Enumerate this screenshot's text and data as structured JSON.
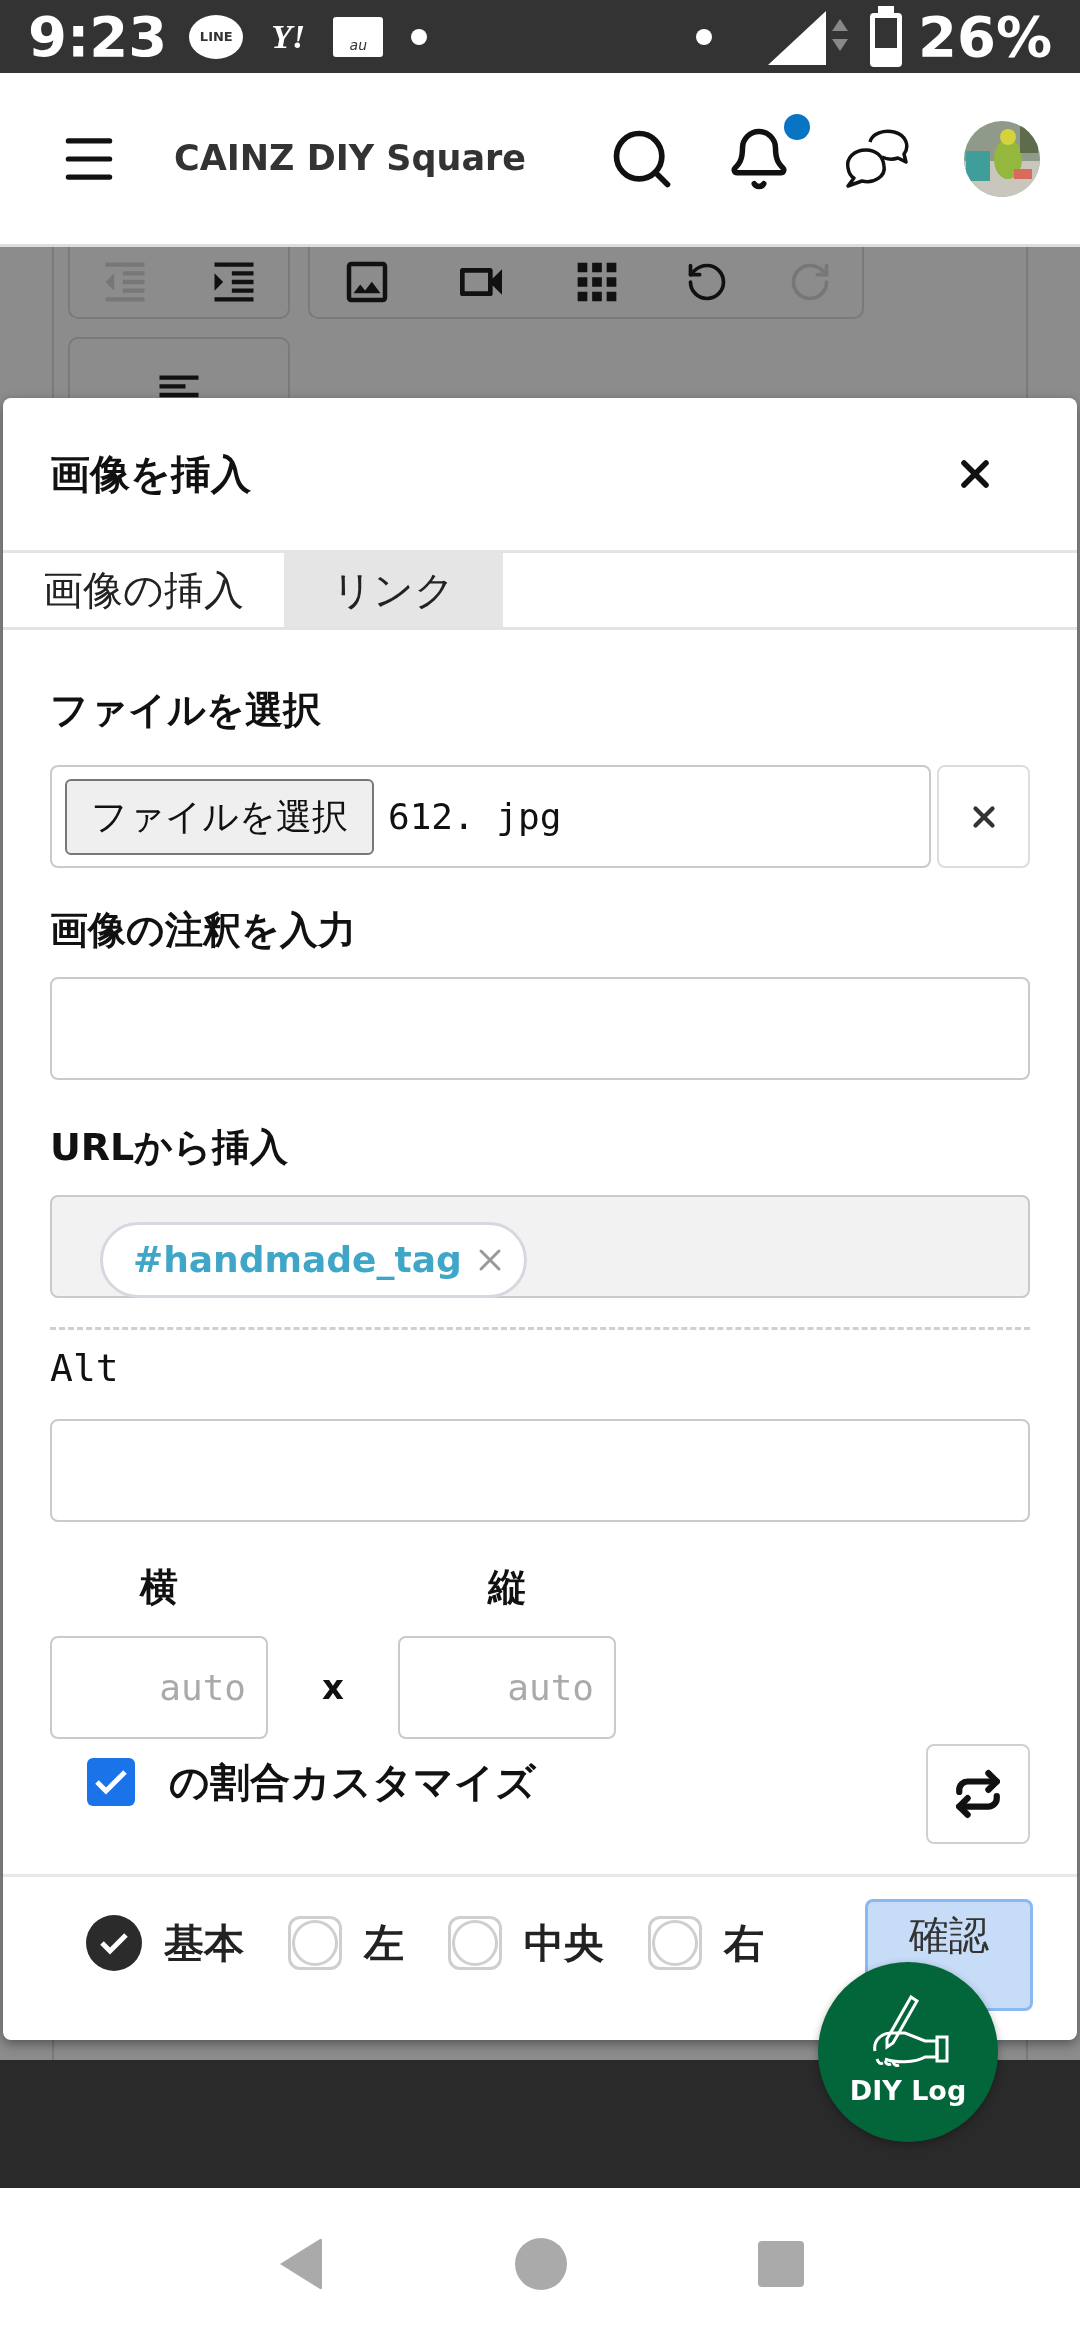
{
  "status_bar": {
    "time": "9:23",
    "notifications": [
      {
        "kind": "bubble",
        "label": "LINE"
      },
      {
        "kind": "plain",
        "label": "Y!"
      },
      {
        "kind": "mail",
        "label": "au"
      }
    ],
    "battery": "26%"
  },
  "header": {
    "title": "CAINZ DIY Square",
    "notification_dot": true
  },
  "dialog": {
    "title": "画像を挿入",
    "tabs": [
      {
        "label": "画像の挿入",
        "selected": true
      },
      {
        "label": "リンク",
        "selected": false
      }
    ],
    "file": {
      "label": "ファイルを選択",
      "button": "ファイルを選択",
      "value": "612. jpg"
    },
    "caption": {
      "label": "画像の注釈を入力"
    },
    "url": {
      "label": "URLから挿入",
      "tags": [
        "#handmade_tag"
      ]
    },
    "alt": {
      "label": "Alt"
    },
    "size": {
      "width_label": "横",
      "height_label": "縦",
      "width_placeholder": "auto",
      "height_placeholder": "auto",
      "separator": "x"
    },
    "ratio": {
      "label": "の割合カスタマイズ",
      "checked": true
    },
    "align": [
      {
        "label": "基本",
        "selected": true
      },
      {
        "label": "左",
        "selected": false
      },
      {
        "label": "中央",
        "selected": false
      },
      {
        "label": "右",
        "selected": false
      }
    ],
    "confirm": "確認"
  },
  "fab": {
    "label": "DIY Log"
  }
}
